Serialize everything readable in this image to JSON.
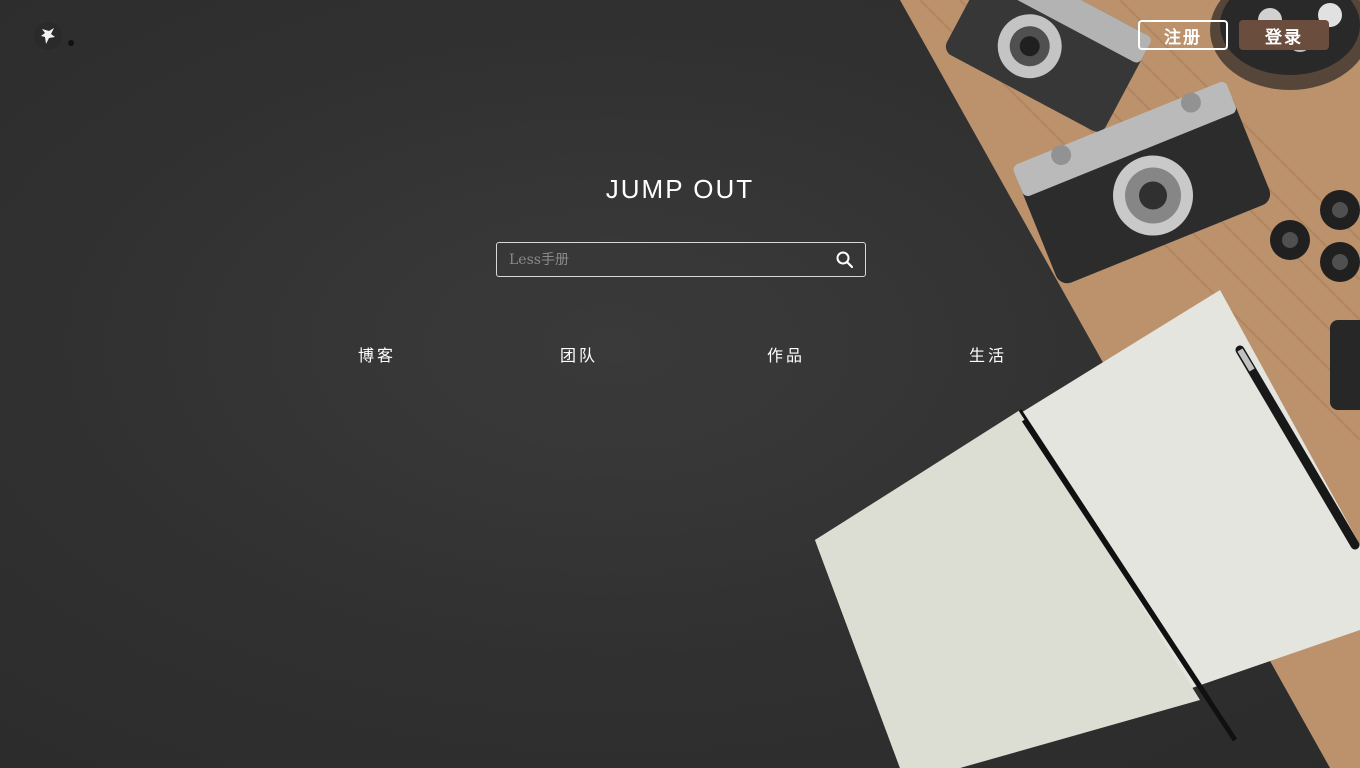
{
  "header": {
    "logo_icon": "fox-logo-icon",
    "register_label": "注册",
    "login_label": "登录"
  },
  "hero": {
    "title": "JUMP OUT"
  },
  "search": {
    "placeholder": "Less手册",
    "value": "",
    "icon": "search-icon"
  },
  "nav": {
    "items": [
      {
        "label": "博客"
      },
      {
        "label": "团队"
      },
      {
        "label": "作品"
      },
      {
        "label": "生活"
      }
    ]
  },
  "colors": {
    "background": "#333333",
    "login_button": "#6b4d3e",
    "text": "#ffffff"
  }
}
